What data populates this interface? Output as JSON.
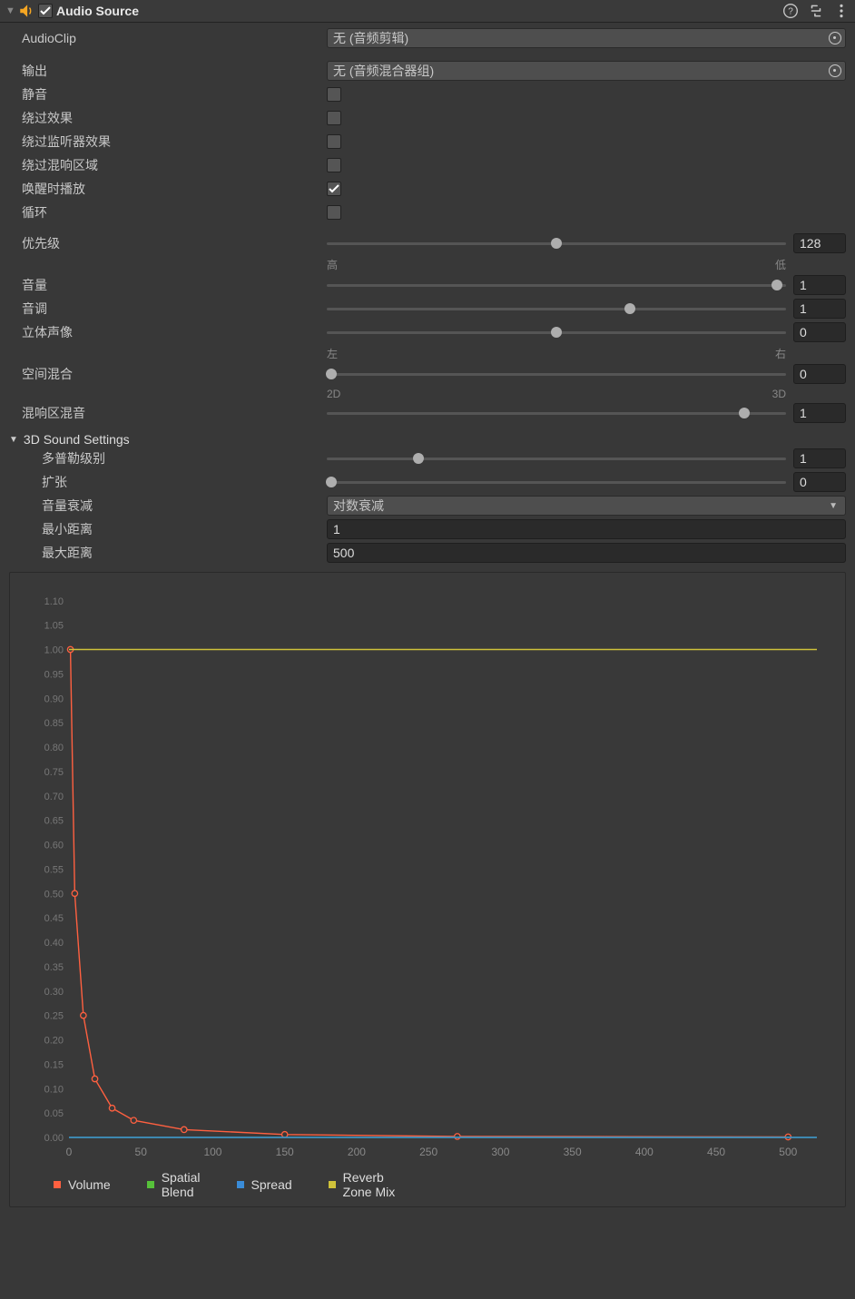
{
  "header": {
    "title": "Audio Source",
    "enabled": true
  },
  "props": {
    "audioClip": {
      "label": "AudioClip",
      "value": "无 (音频剪辑)"
    },
    "output": {
      "label": "输出",
      "value": "无 (音频混合器组)"
    },
    "mute": {
      "label": "静音"
    },
    "bypassFx": {
      "label": "绕过效果"
    },
    "bypassListen": {
      "label": "绕过监听器效果"
    },
    "bypassReverb": {
      "label": "绕过混响区域"
    },
    "playOnAwake": {
      "label": "唤醒时播放",
      "checked": true
    },
    "loop": {
      "label": "循环"
    },
    "priority": {
      "label": "优先级",
      "value": "128",
      "frac": 0.5,
      "lo": "高",
      "hi": "低"
    },
    "volume": {
      "label": "音量",
      "value": "1",
      "frac": 0.98
    },
    "pitch": {
      "label": "音调",
      "value": "1",
      "frac": 0.66
    },
    "pan": {
      "label": "立体声像",
      "value": "0",
      "frac": 0.5,
      "lo": "左",
      "hi": "右"
    },
    "spatial": {
      "label": "空间混合",
      "value": "0",
      "frac": 0.01,
      "lo": "2D",
      "hi": "3D"
    },
    "reverbMix": {
      "label": "混响区混音",
      "value": "1",
      "frac": 0.91
    }
  },
  "section3d": {
    "title": "3D Sound Settings",
    "doppler": {
      "label": "多普勒级别",
      "value": "1",
      "frac": 0.2
    },
    "spread": {
      "label": "扩张",
      "value": "0",
      "frac": 0.01
    },
    "rolloff": {
      "label": "音量衰减",
      "value": "对数衰减"
    },
    "minDist": {
      "label": "最小距离",
      "value": "1"
    },
    "maxDist": {
      "label": "最大距离",
      "value": "500"
    }
  },
  "chart_data": {
    "type": "line",
    "xlabel": "",
    "ylabel": "",
    "xlim": [
      0,
      520
    ],
    "ylim": [
      0,
      1.12
    ],
    "xticks": [
      0,
      50,
      100,
      150,
      200,
      250,
      300,
      350,
      400,
      450,
      500
    ],
    "yticks": [
      0.0,
      0.05,
      0.1,
      0.15,
      0.2,
      0.25,
      0.3,
      0.35,
      0.4,
      0.45,
      0.5,
      0.55,
      0.6,
      0.65,
      0.7,
      0.75,
      0.8,
      0.85,
      0.9,
      0.95,
      1.0,
      1.05,
      1.1
    ],
    "series": [
      {
        "name": "Volume",
        "color": "#ff6040",
        "points": [
          [
            1,
            1.0
          ],
          [
            4,
            0.5
          ],
          [
            10,
            0.25
          ],
          [
            18,
            0.12
          ],
          [
            30,
            0.06
          ],
          [
            45,
            0.035
          ],
          [
            80,
            0.016
          ],
          [
            150,
            0.006
          ],
          [
            270,
            0.002
          ],
          [
            500,
            0.001
          ]
        ]
      },
      {
        "name": "Spatial Blend",
        "color": "#56c13a",
        "points": [
          [
            0,
            0.0
          ],
          [
            520,
            0.0
          ]
        ]
      },
      {
        "name": "Spread",
        "color": "#3a8cd8",
        "points": [
          [
            0,
            0.0
          ],
          [
            520,
            0.0
          ]
        ]
      },
      {
        "name": "Reverb Zone Mix",
        "color": "#cfc23a",
        "points": [
          [
            0,
            1.0
          ],
          [
            520,
            1.0
          ]
        ]
      }
    ],
    "legend": [
      "Volume",
      "Spatial\nBlend",
      "Spread",
      "Reverb\nZone Mix"
    ]
  }
}
